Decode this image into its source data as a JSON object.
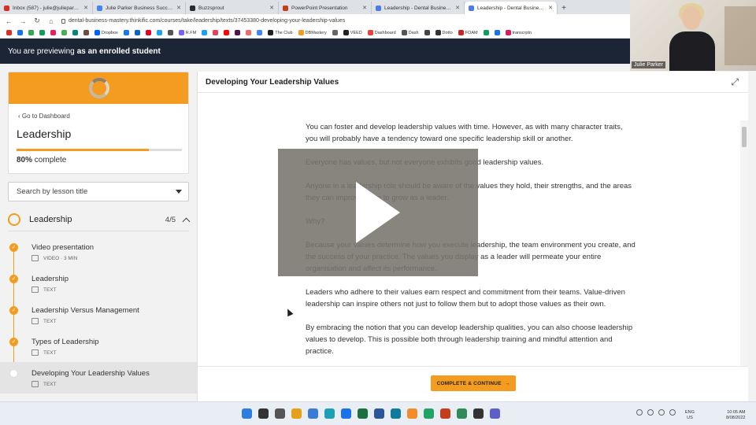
{
  "browser": {
    "tabs": [
      {
        "title": "Inbox (587) - julie@julieparkerp...",
        "active": false,
        "color": "#d93025"
      },
      {
        "title": "Julie Parker Business Success - C...",
        "active": false,
        "color": "#4285f4"
      },
      {
        "title": "Buzzsprout",
        "active": false,
        "color": "#2b2b2b"
      },
      {
        "title": "PowerPoint Presentation",
        "active": false,
        "color": "#c43e1c"
      },
      {
        "title": "Leadership - Dental Business M...",
        "active": false,
        "color": "#4b7bec"
      },
      {
        "title": "Leadership - Dental Business Ma...",
        "active": true,
        "color": "#4b7bec"
      }
    ],
    "url": "dental-business-mastery.thinkific.com/courses/take/leadership/texts/37453380-developing-your-leadership-values",
    "bookmarks": [
      {
        "label": "",
        "color": "#d93025"
      },
      {
        "label": "",
        "color": "#1a73e8"
      },
      {
        "label": "",
        "color": "#34a853"
      },
      {
        "label": "",
        "color": "#0f9d58"
      },
      {
        "label": "",
        "color": "#e91e63"
      },
      {
        "label": "",
        "color": "#4caf50"
      },
      {
        "label": "",
        "color": "#00897b"
      },
      {
        "label": "",
        "color": "#6d4c41"
      },
      {
        "label": "Dropbox",
        "color": "#0061fe"
      },
      {
        "label": "",
        "color": "#1877f2"
      },
      {
        "label": "",
        "color": "#0a66c2"
      },
      {
        "label": "",
        "color": "#e60023"
      },
      {
        "label": "",
        "color": "#1da1f2"
      },
      {
        "label": "",
        "color": "#555"
      },
      {
        "label": "R.FM",
        "color": "#7b61ff"
      },
      {
        "label": "",
        "color": "#1da1f2"
      },
      {
        "label": "",
        "color": "#e4405f"
      },
      {
        "label": "",
        "color": "#ff0000"
      },
      {
        "label": "",
        "color": "#4a154b"
      },
      {
        "label": "",
        "color": "#f06a6a"
      },
      {
        "label": "",
        "color": "#4285f4"
      },
      {
        "label": "The Club",
        "color": "#222"
      },
      {
        "label": "DBMastery",
        "color": "#f39c1f"
      },
      {
        "label": "",
        "color": "#666"
      },
      {
        "label": "VEED",
        "color": "#222"
      },
      {
        "label": "Dashboard",
        "color": "#ea4335"
      },
      {
        "label": "Dash",
        "color": "#555"
      },
      {
        "label": "",
        "color": "#444"
      },
      {
        "label": "Dotto",
        "color": "#333"
      },
      {
        "label": "FOAM",
        "color": "#c62828"
      },
      {
        "label": "",
        "color": "#0f9d58"
      },
      {
        "label": "",
        "color": "#1a73e8"
      },
      {
        "label": "transcrptn",
        "color": "#d81b60"
      }
    ]
  },
  "banner": {
    "prefix": "You are previewing",
    "role": "as an enrolled student"
  },
  "webcam": {
    "name": "Julie Parker"
  },
  "sidebar": {
    "back_label": "Go to Dashboard",
    "course_title": "Leadership",
    "progress": {
      "percent": 80,
      "percent_label": "80%",
      "suffix": "complete"
    },
    "search_placeholder": "Search by lesson title",
    "chapter": {
      "title": "Leadership",
      "count": "4/5"
    },
    "lessons": [
      {
        "title": "Video presentation",
        "type": "VIDEO · 3 MIN",
        "completed": true,
        "active": false
      },
      {
        "title": "Leadership",
        "type": "TEXT",
        "completed": true,
        "active": false
      },
      {
        "title": "Leadership Versus Management",
        "type": "TEXT",
        "completed": true,
        "active": false
      },
      {
        "title": "Types of Leadership",
        "type": "TEXT",
        "completed": true,
        "active": false
      },
      {
        "title": "Developing Your Leadership Values",
        "type": "TEXT",
        "completed": false,
        "active": true
      }
    ]
  },
  "content": {
    "title": "Developing Your Leadership Values",
    "paragraphs": [
      "You can foster and develop leadership values with time. However, as with many character traits, you will probably have a tendency toward one specific leadership skill or another.",
      "Everyone has values, but not everyone exhibits good leadership values.",
      "Anyone in a leadership role should be aware of the values they hold, their strengths, and the areas they can improve upon to grow as a leader.",
      "Why?",
      "Because your values determine how you execute leadership, the team environment you create, and the success of your practice. The values you display as a leader will permeate your entire organisation and affect its performance.",
      "Leaders who adhere to their values earn respect and commitment from their teams. Value-driven leadership can inspire others not just to follow them but to adopt those values as their own.",
      "By embracing the notion that you can develop leadership qualities, you can also choose leadership values to develop. This is possible both through leadership training and mindful attention and practice."
    ],
    "complete_button": "COMPLETE & CONTINUE"
  },
  "taskbar": {
    "apps": [
      "#2f7de1",
      "#333",
      "#555",
      "#e6a118",
      "#3a7bd5",
      "#1ea0b4",
      "#1a73e8",
      "#1d6f42",
      "#2b579a",
      "#0f7b9b",
      "#f28c28",
      "#21a366",
      "#c43e1c",
      "#2d8c5a",
      "#333",
      "#5b5fc7"
    ],
    "lang_top": "ENG",
    "lang_bottom": "US",
    "time": "10:05 AM",
    "date": "8/08/2022"
  }
}
